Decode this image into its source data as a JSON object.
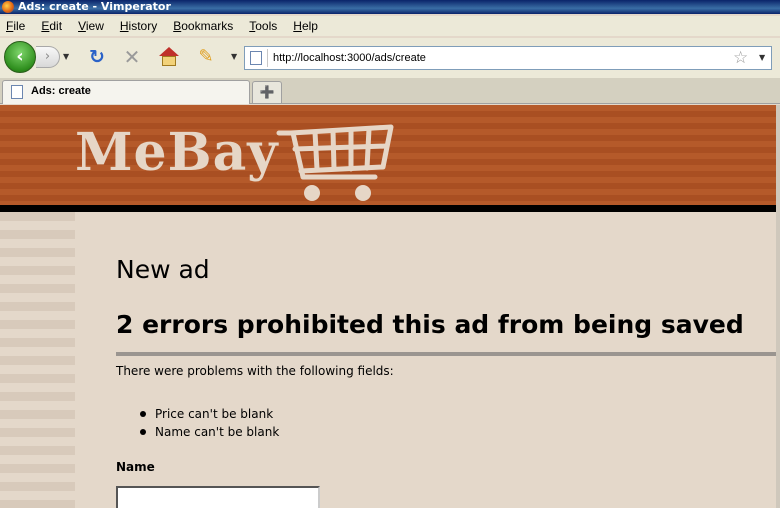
{
  "window": {
    "title": "Ads: create - Vimperator"
  },
  "menu": [
    "File",
    "Edit",
    "View",
    "History",
    "Bookmarks",
    "Tools",
    "Help"
  ],
  "address_bar": {
    "url": "http://localhost:3000/ads/create"
  },
  "tabs": [
    {
      "label": "Ads: create"
    }
  ],
  "site": {
    "logo": "MeBay"
  },
  "page": {
    "heading": "New ad",
    "error_heading": "2 errors prohibited this ad from being saved",
    "error_intro": "There were problems with the following fields:",
    "errors": [
      "Price can't be blank",
      "Name can't be blank"
    ],
    "name_label": "Name",
    "name_value": ""
  },
  "colors": {
    "banner": "#b55a2a",
    "page_bg": "#e4d8ca",
    "logo": "#e6d6c6"
  }
}
